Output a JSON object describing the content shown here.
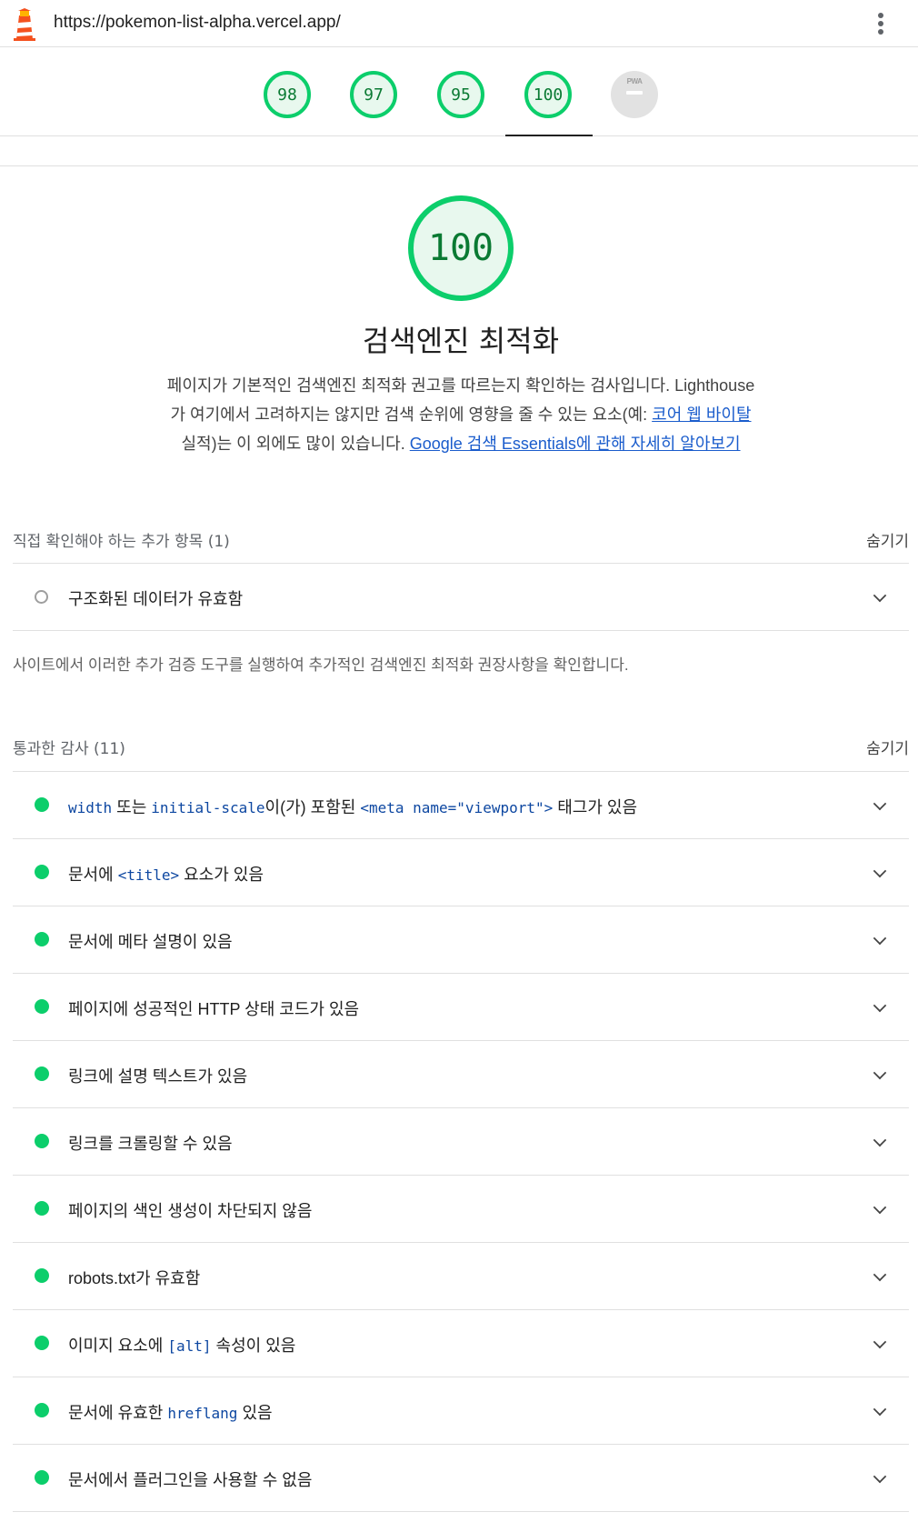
{
  "browser": {
    "url": "https://pokemon-list-alpha.vercel.app/",
    "logo_icon": "lighthouse-icon",
    "menu_icon": "kebab-menu-icon"
  },
  "score_gauges": [
    {
      "score": "98"
    },
    {
      "score": "97"
    },
    {
      "score": "95"
    },
    {
      "score": "100"
    },
    {
      "label": "PWA"
    }
  ],
  "category": {
    "score": "100",
    "title": "검색엔진 최적화",
    "description_1": "페이지가 기본적인 검색엔진 최적화 권고를 따르는지 확인하는 검사입니다. Lighthouse가 여기에서 고려하지는 않지만 검색 순위에 영향을 줄 수 있는 요소(예: ",
    "link_1": "코어 웹 바이탈",
    "description_2": " 실적)는 이 외에도 많이 있습니다. ",
    "link_2": "Google 검색 Essentials에 관해 자세히 알아보기"
  },
  "manual_group": {
    "title": "직접 확인해야 하는 추가 항목 (1)",
    "toggle": "숨기기",
    "items": [
      {
        "label": "구조화된 데이터가 유효함"
      }
    ],
    "description": "사이트에서 이러한 추가 검증 도구를 실행하여 추가적인 검색엔진 최적화 권장사항을 확인합니다."
  },
  "passed_group": {
    "title": "통과한 감사 (11)",
    "toggle": "숨기기",
    "items": [
      {
        "code1": "width",
        "t1": " 또는 ",
        "code2": "initial-scale",
        "t2": "이(가) 포함된 ",
        "code3": "<meta name=\"viewport\">",
        "t3": " 태그가 있음"
      },
      {
        "t1": "문서에 ",
        "code1": "<title>",
        "t2": " 요소가 있음"
      },
      {
        "label": "문서에 메타 설명이 있음"
      },
      {
        "label": "페이지에 성공적인 HTTP 상태 코드가 있음"
      },
      {
        "label": "링크에 설명 텍스트가 있음"
      },
      {
        "label": "링크를 크롤링할 수 있음"
      },
      {
        "label": "페이지의 색인 생성이 차단되지 않음"
      },
      {
        "label": "robots.txt가 유효함"
      },
      {
        "t1": "이미지 요소에 ",
        "code1": "[alt]",
        "t2": " 속성이 있음"
      },
      {
        "t1": "문서에 유효한 ",
        "code1": "hreflang",
        "t2": " 있음"
      },
      {
        "label": "문서에서 플러그인을 사용할 수 없음"
      }
    ]
  },
  "colors": {
    "pass": "#0cce6b",
    "pass_text": "#0a7a33",
    "link": "#1a5ccc",
    "code": "#0d47a1"
  }
}
